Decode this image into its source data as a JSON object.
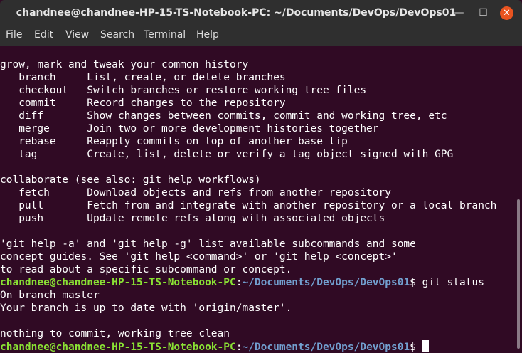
{
  "window": {
    "title": "chandnee@chandnee-HP-15-TS-Notebook-PC: ~/Documents/DevOps/DevOps01",
    "controls": {
      "minimize": "—",
      "maximize": "☐",
      "close": "✕"
    }
  },
  "menu": [
    "File",
    "Edit",
    "View",
    "Search",
    "Terminal",
    "Help"
  ],
  "terminal": {
    "lines": [
      "grow, mark and tweak your common history",
      "   branch     List, create, or delete branches",
      "   checkout   Switch branches or restore working tree files",
      "   commit     Record changes to the repository",
      "   diff       Show changes between commits, commit and working tree, etc",
      "   merge      Join two or more development histories together",
      "   rebase     Reapply commits on top of another base tip",
      "   tag        Create, list, delete or verify a tag object signed with GPG",
      "",
      "collaborate (see also: git help workflows)",
      "   fetch      Download objects and refs from another repository",
      "   pull       Fetch from and integrate with another repository or a local branch",
      "   push       Update remote refs along with associated objects",
      "",
      "'git help -a' and 'git help -g' list available subcommands and some",
      "concept guides. See 'git help <command>' or 'git help <concept>'",
      "to read about a specific subcommand or concept."
    ],
    "prompt_user": "chandnee@chandnee-HP-15-TS-Notebook-PC",
    "prompt_colon": ":",
    "prompt_path": "~/Documents/DevOps/DevOps01",
    "prompt_symbol": "$",
    "command": " git status",
    "output": [
      "On branch master",
      "Your branch is up to date with 'origin/master'.",
      "",
      "nothing to commit, working tree clean"
    ],
    "final_prompt_user": "chandnee@chandnee-HP-15-TS-Notebook-PC",
    "final_prompt_colon": ":",
    "final_prompt_path": "~/Documents/DevOps/DevOps01",
    "final_prompt_symbol": "$ "
  },
  "colors": {
    "background": "#300a24",
    "user": "#8ae234",
    "path": "#729fcf",
    "close_button": "#e95420"
  }
}
